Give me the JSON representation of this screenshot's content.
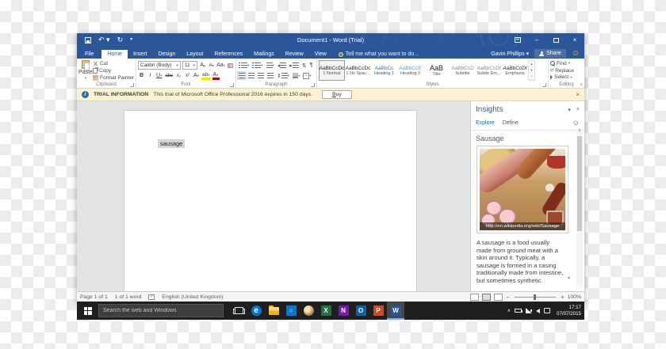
{
  "window": {
    "title": "Document1 - Word (Trial)"
  },
  "tabs": {
    "items": [
      "File",
      "Home",
      "Insert",
      "Design",
      "Layout",
      "References",
      "Mailings",
      "Review",
      "View"
    ],
    "tell_me": "Tell me what you want to do...",
    "user": "Gavin Phillips",
    "share": "Share"
  },
  "ribbon": {
    "clipboard": {
      "label": "Clipboard",
      "paste": "Paste",
      "cut": "Cut",
      "copy": "Copy",
      "format_painter": "Format Painter"
    },
    "font": {
      "label": "Font",
      "name": "Calibri (Body)",
      "size": "11",
      "bold": "B",
      "italic": "I",
      "underline": "U",
      "strikethrough": "abc",
      "subscript": "x₂",
      "superscript": "x²",
      "grow": "A",
      "shrink": "A",
      "change_case": "Aa",
      "text_effects": "A",
      "highlight": "ab",
      "font_color": "A"
    },
    "paragraph": {
      "label": "Paragraph",
      "sort": "⇅",
      "pilcrow": "¶"
    },
    "styles": {
      "label": "Styles",
      "items": [
        {
          "preview": "AaBbCcDc",
          "name": "1 Normal"
        },
        {
          "preview": "AaBbCcDc",
          "name": "1 No Spac..."
        },
        {
          "preview": "AaBbCc",
          "name": "Heading 1"
        },
        {
          "preview": "AaBbCcE",
          "name": "Heading 2"
        },
        {
          "preview": "AaB",
          "name": "Title"
        },
        {
          "preview": "AaBbCcD",
          "name": "Subtitle"
        },
        {
          "preview": "AaBbCcDt",
          "name": "Subtle Em..."
        },
        {
          "preview": "AaBbCcDt",
          "name": "Emphasis"
        }
      ]
    },
    "editing": {
      "label": "Editing",
      "find": "Find",
      "replace": "Replace",
      "select": "Select"
    }
  },
  "trial_bar": {
    "label": "TRIAL INFORMATION",
    "message": "This trial of Microsoft Office Professional 2016 expires in 150 days.",
    "buy_label": "Buy"
  },
  "document": {
    "selected_text": "sausage"
  },
  "insights": {
    "title": "Insights",
    "explore_tab": "Explore",
    "define_tab": "Define",
    "topic": "Sausage",
    "image_caption": "http://en.wikipedia.org/wiki/Sausage",
    "description": "A sausage is a food usually made from ground meat with a skin around it. Typically, a sausage is formed in a casing traditionally made from intestine, but sometimes synthetic."
  },
  "status_bar": {
    "page_count": "Page 1 of 1",
    "word_count": "1 of 1 word",
    "language": "English (United Kingdom)",
    "zoom_level": "100%"
  },
  "taskbar": {
    "search_placeholder": "Search the web and Windows",
    "time": "17:17",
    "date": "07/07/2015"
  },
  "colors": {
    "titlebar_blue": "#2b579a",
    "trial_yellow": "#fbf3cf",
    "taskbar_dark": "#1f1f1f",
    "insights_link_blue": "#0f6cbd"
  }
}
